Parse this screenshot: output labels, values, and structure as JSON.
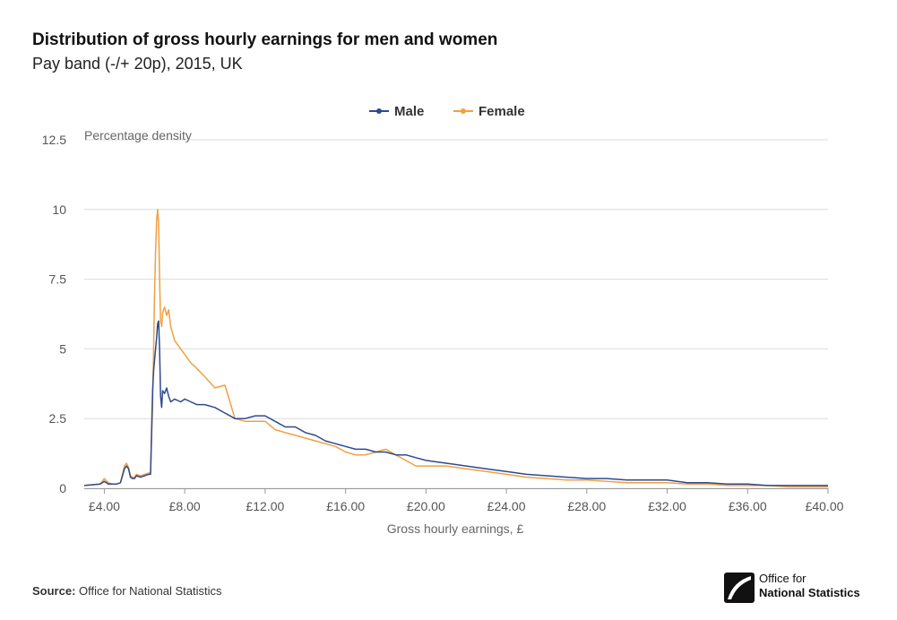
{
  "header": {
    "title": "Distribution of gross hourly earnings for men and women",
    "subtitle": "Pay band (-/+ 20p), 2015, UK"
  },
  "footer": {
    "source_label": "Source:",
    "source_text": "Office for National Statistics",
    "logo_line1": "Office for",
    "logo_line2": "National Statistics"
  },
  "colors": {
    "male": "#2e4a8e",
    "female": "#f0a040",
    "grid": "#dcdcdc",
    "axis_text": "#555555"
  },
  "chart_data": {
    "type": "line",
    "ylabel": "Percentage density",
    "xlabel": "Gross hourly earnings, £",
    "xlim": [
      3,
      40
    ],
    "ylim": [
      0,
      12.5
    ],
    "x_ticks": [
      4,
      8,
      12,
      16,
      20,
      24,
      28,
      32,
      36,
      40
    ],
    "x_tick_labels": [
      "£4.00",
      "£8.00",
      "£12.00",
      "£16.00",
      "£20.00",
      "£24.00",
      "£28.00",
      "£32.00",
      "£36.00",
      "£40.00"
    ],
    "y_ticks": [
      0,
      2.5,
      5,
      7.5,
      10,
      12.5
    ],
    "y_tick_labels": [
      "0",
      "2.5",
      "5",
      "7.5",
      "10",
      "12.5"
    ],
    "legend_position": "top-center",
    "series": [
      {
        "name": "Male",
        "x": [
          3,
          3.8,
          4,
          4.2,
          4.4,
          4.6,
          4.8,
          5.0,
          5.1,
          5.2,
          5.3,
          5.4,
          5.5,
          5.6,
          5.8,
          6.0,
          6.2,
          6.3,
          6.4,
          6.45,
          6.5,
          6.55,
          6.6,
          6.65,
          6.7,
          6.75,
          6.8,
          6.85,
          6.9,
          7.0,
          7.1,
          7.2,
          7.3,
          7.5,
          7.8,
          8.0,
          8.3,
          8.6,
          9.0,
          9.5,
          10.0,
          10.5,
          11.0,
          11.5,
          12.0,
          12.5,
          13.0,
          13.5,
          14.0,
          14.5,
          15.0,
          15.5,
          16.0,
          16.5,
          17.0,
          17.5,
          18.0,
          18.5,
          19.0,
          19.5,
          20.0,
          21.0,
          22.0,
          23.0,
          24.0,
          25.0,
          26.0,
          27.0,
          28.0,
          29.0,
          30.0,
          31.0,
          32.0,
          33.0,
          34.0,
          35.0,
          36.0,
          37.0,
          38.0,
          39.0,
          40.0
        ],
        "values": [
          0.1,
          0.15,
          0.25,
          0.15,
          0.15,
          0.15,
          0.2,
          0.7,
          0.8,
          0.7,
          0.4,
          0.35,
          0.35,
          0.45,
          0.4,
          0.45,
          0.5,
          0.5,
          3.5,
          4.2,
          4.6,
          5.0,
          5.4,
          5.9,
          6.0,
          5.0,
          3.3,
          2.9,
          3.5,
          3.4,
          3.6,
          3.3,
          3.1,
          3.2,
          3.1,
          3.2,
          3.1,
          3.0,
          3.0,
          2.9,
          2.7,
          2.5,
          2.5,
          2.6,
          2.6,
          2.4,
          2.2,
          2.2,
          2.0,
          1.9,
          1.7,
          1.6,
          1.5,
          1.4,
          1.4,
          1.3,
          1.3,
          1.2,
          1.2,
          1.1,
          1.0,
          0.9,
          0.8,
          0.7,
          0.6,
          0.5,
          0.45,
          0.4,
          0.35,
          0.35,
          0.3,
          0.3,
          0.3,
          0.2,
          0.2,
          0.15,
          0.15,
          0.1,
          0.1,
          0.1,
          0.1
        ]
      },
      {
        "name": "Female",
        "x": [
          3,
          3.8,
          4,
          4.2,
          4.4,
          4.6,
          4.8,
          5.0,
          5.1,
          5.2,
          5.3,
          5.4,
          5.5,
          5.6,
          5.8,
          6.0,
          6.2,
          6.3,
          6.4,
          6.45,
          6.5,
          6.55,
          6.6,
          6.65,
          6.7,
          6.75,
          6.8,
          6.85,
          6.9,
          7.0,
          7.1,
          7.2,
          7.3,
          7.5,
          7.8,
          8.0,
          8.3,
          8.6,
          9.0,
          9.5,
          10.0,
          10.5,
          11.0,
          11.5,
          12.0,
          12.5,
          13.0,
          13.5,
          14.0,
          14.5,
          15.0,
          15.5,
          16.0,
          16.5,
          17.0,
          17.5,
          18.0,
          18.5,
          19.0,
          19.5,
          20.0,
          21.0,
          22.0,
          23.0,
          24.0,
          25.0,
          26.0,
          27.0,
          28.0,
          29.0,
          30.0,
          31.0,
          32.0,
          33.0,
          34.0,
          35.0,
          36.0,
          37.0,
          38.0,
          39.0,
          40.0
        ],
        "values": [
          0.1,
          0.15,
          0.35,
          0.2,
          0.15,
          0.15,
          0.2,
          0.8,
          0.9,
          0.75,
          0.45,
          0.4,
          0.4,
          0.5,
          0.45,
          0.5,
          0.55,
          0.55,
          3.0,
          5.0,
          7.0,
          8.5,
          9.6,
          10.0,
          9.5,
          7.5,
          6.0,
          5.8,
          6.3,
          6.5,
          6.2,
          6.4,
          5.8,
          5.3,
          5.0,
          4.8,
          4.5,
          4.3,
          4.0,
          3.6,
          3.7,
          2.5,
          2.4,
          2.4,
          2.4,
          2.1,
          2.0,
          1.9,
          1.8,
          1.7,
          1.6,
          1.5,
          1.3,
          1.2,
          1.2,
          1.3,
          1.4,
          1.2,
          1.0,
          0.8,
          0.8,
          0.8,
          0.7,
          0.6,
          0.5,
          0.4,
          0.35,
          0.3,
          0.3,
          0.25,
          0.2,
          0.2,
          0.2,
          0.15,
          0.15,
          0.1,
          0.1,
          0.1,
          0.05,
          0.05,
          0.05
        ]
      }
    ]
  }
}
